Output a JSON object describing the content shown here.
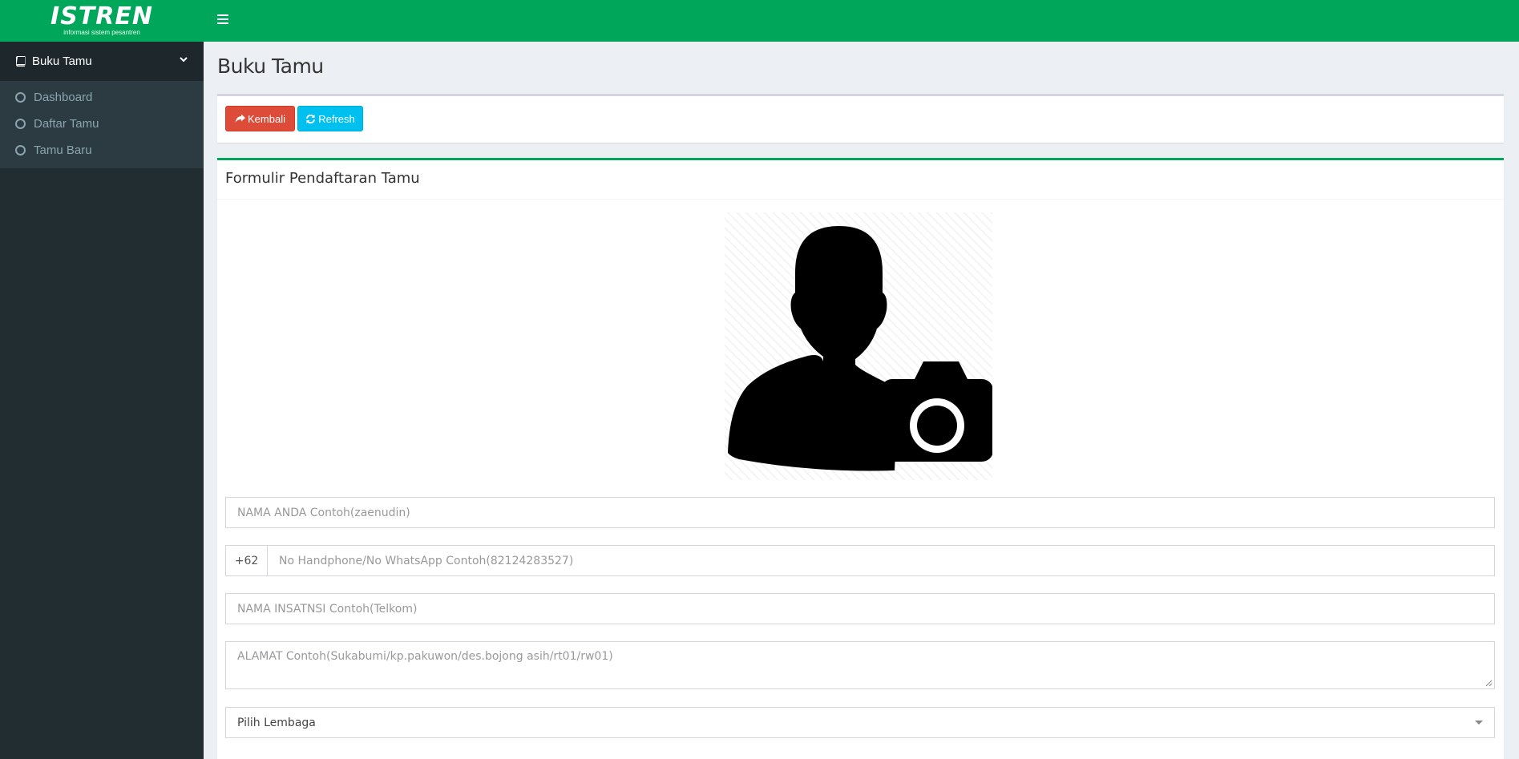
{
  "brand": {
    "title": "ISTREN",
    "subtitle": "informasi sistem pesantren",
    "accent": "#00a65a"
  },
  "sidebar": {
    "menu_label": "Buku Tamu",
    "items": [
      {
        "label": "Dashboard"
      },
      {
        "label": "Daftar Tamu"
      },
      {
        "label": "Tamu Baru"
      }
    ]
  },
  "page": {
    "title": "Buku Tamu"
  },
  "toolbar": {
    "back_label": "Kembali",
    "refresh_label": "Refresh"
  },
  "form": {
    "title": "Formulir Pendaftaran Tamu",
    "photo_icon": "user-camera-icon",
    "name_placeholder": "NAMA ANDA Contoh(zaenudin)",
    "phone_prefix": "+62",
    "phone_placeholder": "No Handphone/No WhatsApp Contoh(82124283527)",
    "institution_placeholder": "NAMA INSATNSI Contoh(Telkom)",
    "address_placeholder": "ALAMAT Contoh(Sukabumi/kp.pakuwon/des.bojong asih/rt01/rw01)",
    "lembaga_selected": "Pilih Lembaga"
  }
}
